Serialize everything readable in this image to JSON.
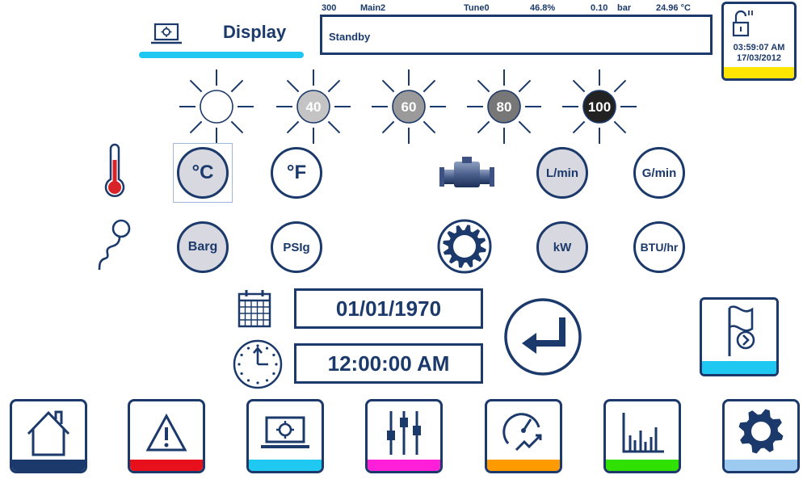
{
  "header": {
    "tab_label": "Display"
  },
  "status": {
    "line": [
      "300",
      "Main2",
      "Tune0",
      "46.8%",
      "0.10",
      "bar",
      "24.96 °C"
    ],
    "state": "Standby"
  },
  "clock": {
    "time": "03:59:07 AM",
    "date": "17/03/2012",
    "accent": "#ffe600"
  },
  "brightness": {
    "levels": [
      "",
      "40",
      "60",
      "80",
      "100"
    ],
    "fills": [
      "#ffffff",
      "#c4c4c4",
      "#9a9a9a",
      "#777777",
      "#222222"
    ]
  },
  "units": {
    "temp_c": "°C",
    "temp_f": "°F",
    "flow_lmin": "L/min",
    "flow_gmin": "G/min",
    "pres_barg": "Barg",
    "pres_psig": "PSIg",
    "power_kw": "kW",
    "power_btu": "BTU/hr"
  },
  "datetime": {
    "date": "01/01/1970",
    "time": "12:00:00 AM"
  },
  "nav": {
    "colors": [
      "#1b3a6b",
      "#e8101a",
      "#1ec8f0",
      "#ff1fd8",
      "#ff9a00",
      "#30e000",
      "#9dcaf0"
    ],
    "flag_accent": "#1ec8f0"
  }
}
